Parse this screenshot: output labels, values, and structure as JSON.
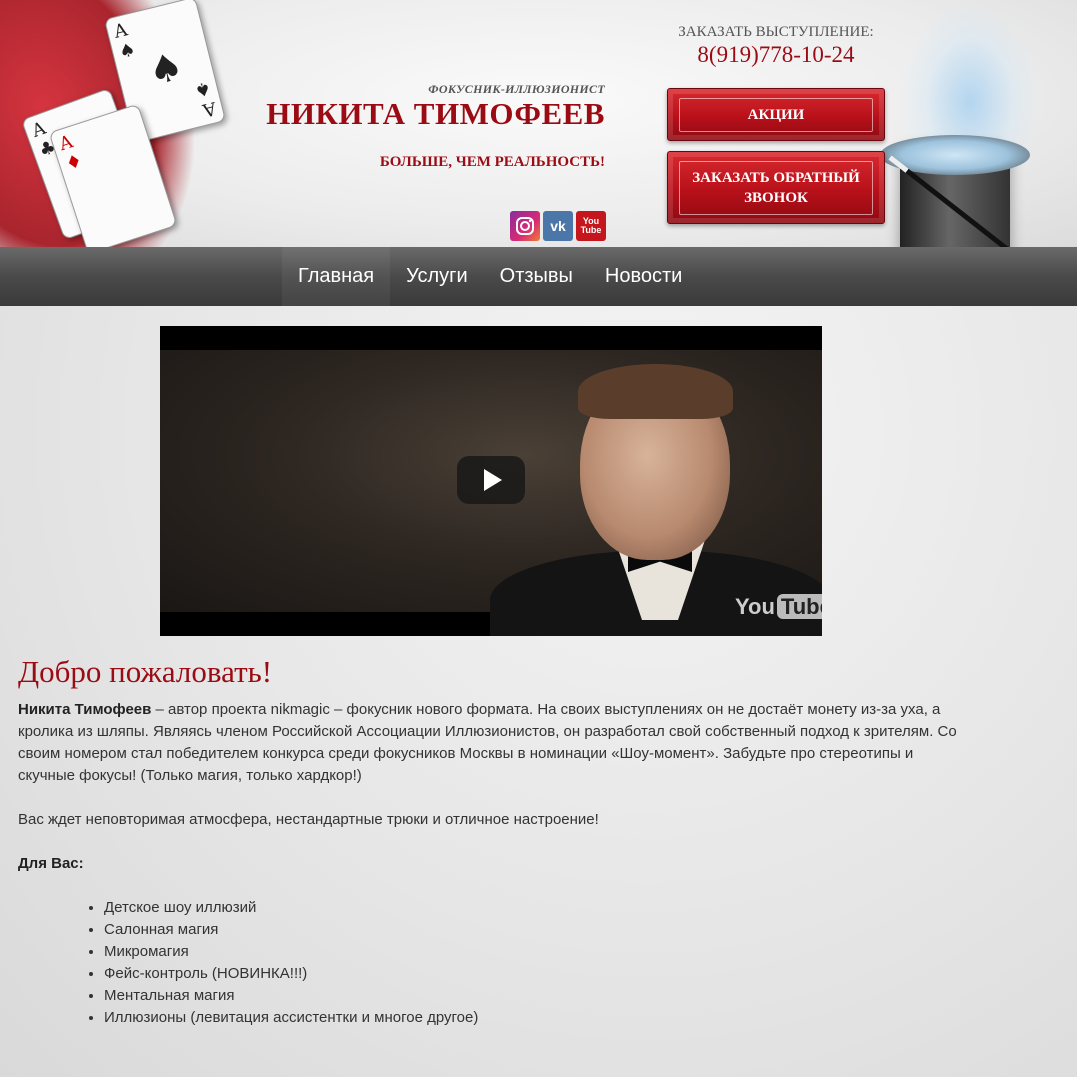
{
  "header": {
    "subtitle": "ФОКУСНИК-ИЛЛЮЗИОНИСТ",
    "title": "НИКИТА ТИМОФЕЕВ",
    "slogan": "БОЛЬШЕ, ЧЕМ РЕАЛЬНОСТЬ!",
    "order_label": "ЗАКАЗАТЬ ВЫСТУПЛЕНИЕ:",
    "phone": "8(919)778-10-24",
    "promo_button": "АКЦИИ",
    "callback_button": "ЗАКАЗАТЬ ОБРАТНЫЙ ЗВОНОК",
    "social": {
      "instagram_icon": "instagram-icon",
      "vk_label": "vk",
      "youtube_top": "You",
      "youtube_bottom": "Tube"
    },
    "accent_color": "#9b0b14"
  },
  "nav": {
    "items": [
      "Главная",
      "Услуги",
      "Отзывы",
      "Новости"
    ]
  },
  "video": {
    "brand_you": "You",
    "brand_tube": "Tube"
  },
  "main": {
    "welcome_heading": "Добро пожаловать!",
    "intro_name": "Никита Тимофеев",
    "intro_text": " – автор проекта nikmagic – фокусник нового формата. На своих выступлениях он не достаёт монету из-за уха, а кролика из шляпы. Являясь членом Российской Ассоциации Иллюзионистов, он разработал свой собственный подход к зрителям. Со своим номером стал победителем конкурса среди фокусников Москвы в номинации «Шоу-момент». Забудьте про стереотипы и скучные фокусы! (Только магия, только хардкор!)",
    "atmosphere": "Вас ждет неповторимая атмосфера, нестандартные трюки и отличное настроение!",
    "for_you_label": "Для Вас:",
    "services": [
      "Детское шоу иллюзий",
      "Салонная магия",
      "Микромагия",
      "Фейс-контроль (НОВИНКА!!!)",
      "Ментальная магия",
      "Иллюзионы (левитация ассистентки и многое другое)"
    ]
  }
}
